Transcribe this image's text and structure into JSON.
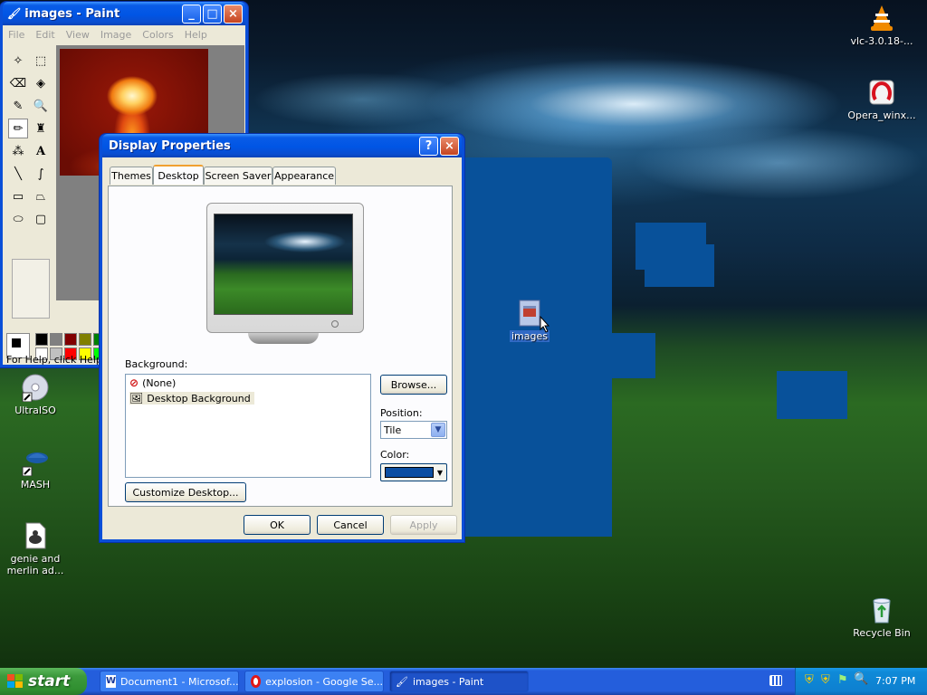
{
  "paint": {
    "title": "images - Paint",
    "menu": [
      "File",
      "Edit",
      "View",
      "Image",
      "Colors",
      "Help"
    ],
    "status": "For Help, click Help To"
  },
  "dialog": {
    "title": "Display Properties",
    "help_btn": "?",
    "close_btn": "×",
    "tabs": [
      "Themes",
      "Desktop",
      "Screen Saver",
      "Appearance"
    ],
    "background_label": "Background:",
    "backgrounds": [
      "(None)",
      "Desktop Background"
    ],
    "browse": "Browse...",
    "position_label": "Position:",
    "position_value": "Tile",
    "color_label": "Color:",
    "color_value": "#0b4ea2",
    "customize": "Customize Desktop...",
    "ok": "OK",
    "cancel": "Cancel",
    "apply": "Apply"
  },
  "desktop": {
    "icons": {
      "vlc": "vlc-3.0.18-...",
      "opera": "Opera_winx...",
      "ultraiso": "UltraISO",
      "mash": "MASH",
      "genie": "genie and merlin ad...",
      "images": "images",
      "recycle": "Recycle Bin"
    }
  },
  "taskbar": {
    "start": "start",
    "items": [
      "Document1 - Microsof...",
      "explosion - Google Se...",
      "images - Paint"
    ],
    "clock": "7:07 PM"
  }
}
